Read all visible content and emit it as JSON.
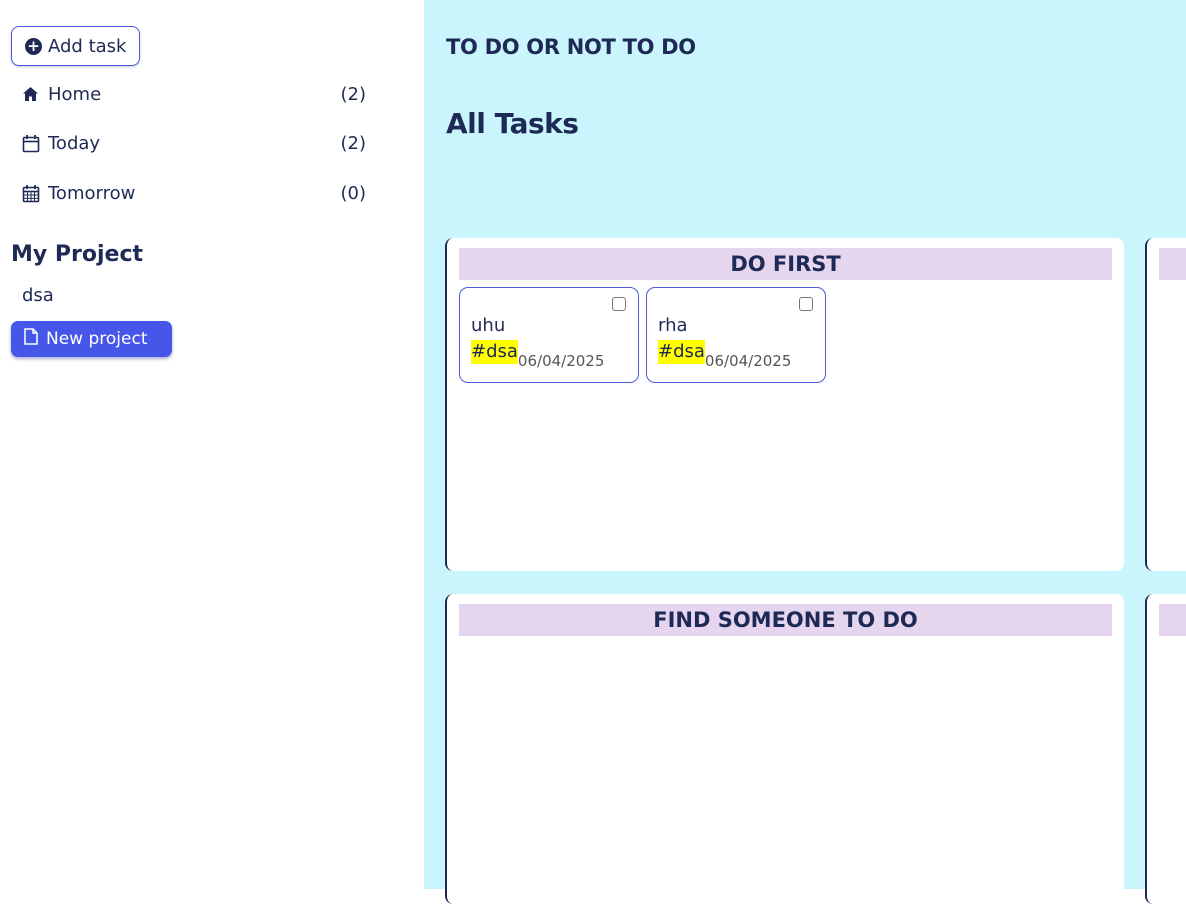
{
  "sidebar": {
    "add_task_label": "Add task",
    "nav": [
      {
        "icon": "home-icon",
        "label": "Home",
        "count": "(2)"
      },
      {
        "icon": "calendar-icon",
        "label": "Today",
        "count": "(2)"
      },
      {
        "icon": "calendar-grid-icon",
        "label": "Tomorrow",
        "count": "(0)"
      }
    ],
    "section_title": "My Project",
    "projects": [
      "dsa"
    ],
    "new_project_label": "New project"
  },
  "main": {
    "app_title": "TO DO OR NOT TO DO",
    "page_title": "All Tasks",
    "quadrants": [
      {
        "title": "DO FIRST",
        "tasks": [
          {
            "name": "uhu",
            "tag": "#dsa",
            "date": "06/04/2025",
            "checked": false
          },
          {
            "name": "rha",
            "tag": "#dsa",
            "date": "06/04/2025",
            "checked": false
          }
        ]
      },
      {
        "title": "",
        "tasks": []
      },
      {
        "title": "FIND SOMEONE TO DO",
        "tasks": []
      },
      {
        "title": "",
        "tasks": []
      }
    ]
  },
  "colors": {
    "accent": "#4556e8",
    "main_bg": "#cbf5fc",
    "header_bg": "#e6d5ef",
    "tag_bg": "#ffff00",
    "text": "#1e2a55"
  }
}
